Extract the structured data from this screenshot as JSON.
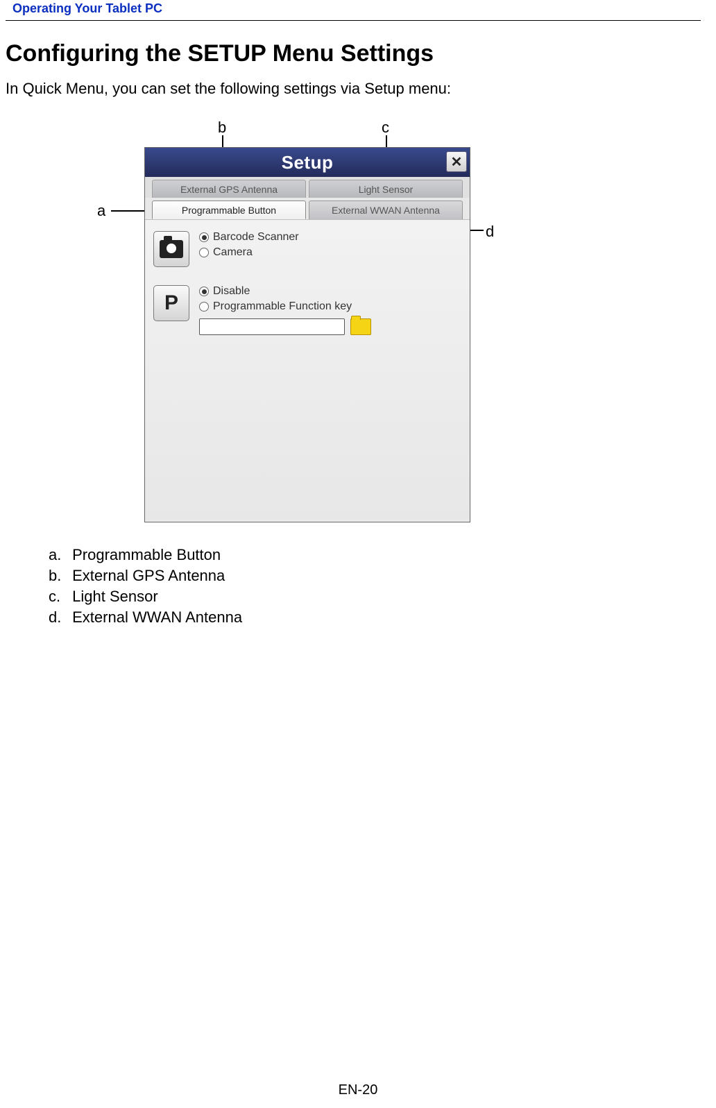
{
  "header": {
    "section_label": "Operating Your Tablet PC"
  },
  "page": {
    "title": "Configuring the SETUP Menu Settings",
    "intro": "In Quick Menu, you can set the following settings via Setup menu:",
    "pagenum": "EN-20"
  },
  "callouts": {
    "a": "a",
    "b": "b",
    "c": "c",
    "d": "d"
  },
  "setup_window": {
    "title": "Setup",
    "tabs_back": [
      {
        "label": "External GPS Antenna"
      },
      {
        "label": "Light Sensor"
      }
    ],
    "tabs_front": [
      {
        "label": "Programmable Button",
        "active": true
      },
      {
        "label": "External WWAN Antenna",
        "active": false
      }
    ],
    "group1": {
      "options": [
        {
          "label": "Barcode Scanner",
          "selected": true
        },
        {
          "label": "Camera",
          "selected": false
        }
      ]
    },
    "group2": {
      "options": [
        {
          "label": "Disable",
          "selected": true
        },
        {
          "label": "Programmable Function key",
          "selected": false
        }
      ]
    }
  },
  "legend": {
    "a_letter": "a.",
    "a": "Programmable Button",
    "b_letter": "b.",
    "b": "External GPS Antenna",
    "c_letter": "c.",
    "c": "Light Sensor",
    "d_letter": "d.",
    "d": "External WWAN Antenna"
  }
}
